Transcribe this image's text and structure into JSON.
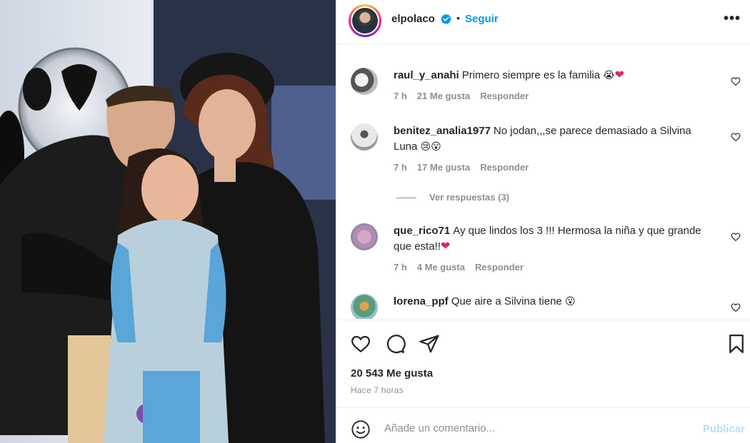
{
  "post": {
    "username": "elpolaco",
    "separator": "•",
    "follow_label": "Seguir",
    "more_label": "•••"
  },
  "comments": [
    {
      "username": "raul_y_anahi",
      "text": "Primero siempre es la familia",
      "emoji": "😭",
      "heart": "❤",
      "time": "7 h",
      "likes": "21 Me gusta",
      "reply": "Responder"
    },
    {
      "username": "benitez_analia1977",
      "text": "No jodan,,,se parece demasiado a Silvina Luna",
      "emoji": "😢😮",
      "time": "7 h",
      "likes": "17 Me gusta",
      "reply": "Responder",
      "view_replies": "Ver respuestas (3)"
    },
    {
      "username": "que_rico71",
      "text": "Ay que lindos los 3 !!! Hermosa la niña y que grande que esta!!",
      "heart": "❤",
      "time": "7 h",
      "likes": "4 Me gusta",
      "reply": "Responder"
    },
    {
      "username": "lorena_ppf",
      "text": "Que aire a Silvina tiene",
      "emoji": "😮"
    }
  ],
  "stats": {
    "likes": "20 543 Me gusta",
    "time_ago": "Hace 7 horas"
  },
  "add_comment": {
    "placeholder": "Añade un comentario...",
    "publish_label": "Publicar"
  },
  "colors": {
    "accent": "#0095f6",
    "publish_disabled": "#b2dffc",
    "heart": "#e0245e",
    "muted": "#8e8e8e"
  },
  "icons": [
    "verified-badge-icon",
    "more-options-icon",
    "heart-icon",
    "comment-icon",
    "share-icon",
    "bookmark-icon",
    "emoji-icon"
  ]
}
